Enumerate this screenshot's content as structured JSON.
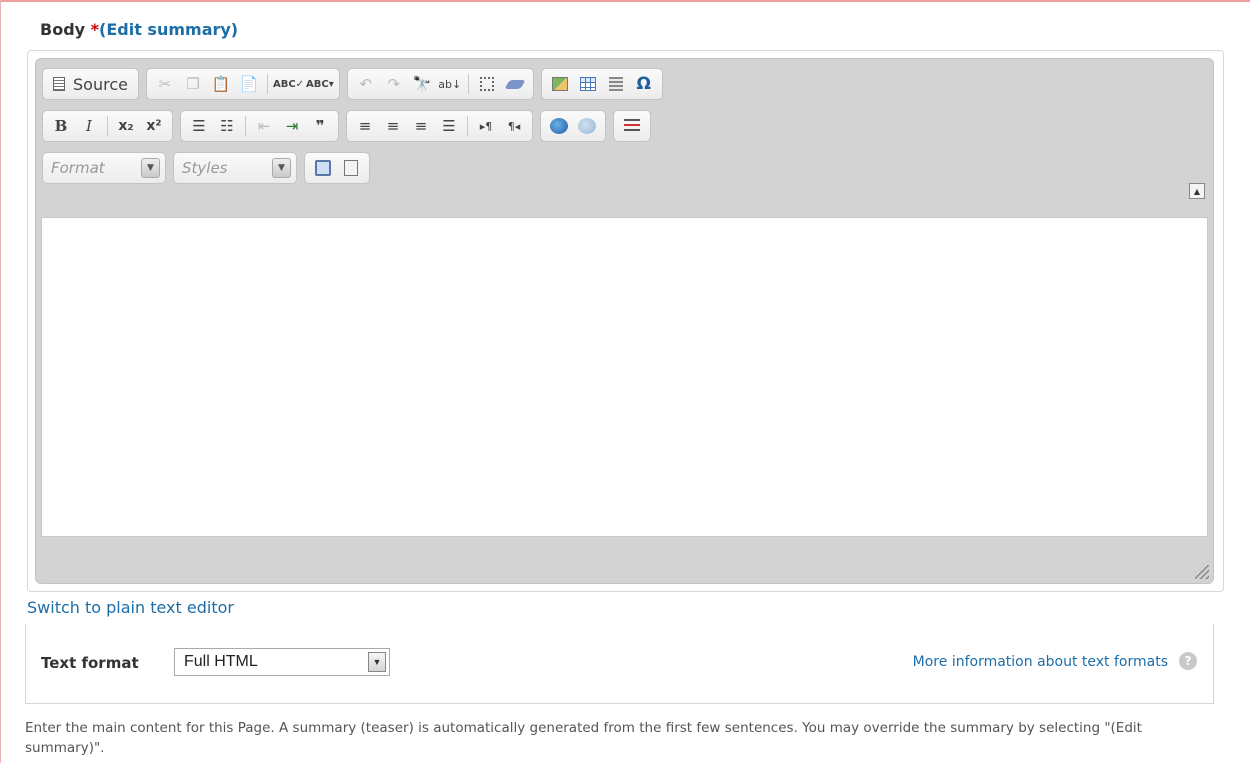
{
  "field": {
    "label": "Body",
    "required_mark": "*",
    "edit_summary_link": "(Edit summary)"
  },
  "toolbar": {
    "source_label": "Source",
    "format_placeholder": "Format",
    "styles_placeholder": "Styles",
    "row1_icons": [
      "source-icon",
      "cut-icon",
      "copy-icon",
      "paste-icon",
      "paste-from-word-icon",
      "spellcheck-icon",
      "spellcheck-as-you-type-icon",
      "undo-icon",
      "redo-icon",
      "find-icon",
      "replace-icon",
      "select-all-icon",
      "remove-format-icon",
      "image-icon",
      "table-icon",
      "horizontal-rule-icon",
      "special-char-icon"
    ],
    "row2_icons": [
      "bold-icon",
      "italic-icon",
      "subscript-icon",
      "superscript-icon",
      "numbered-list-icon",
      "bulleted-list-icon",
      "outdent-icon",
      "indent-icon",
      "blockquote-icon",
      "align-left-icon",
      "align-center-icon",
      "align-right-icon",
      "justify-icon",
      "ltr-icon",
      "rtl-icon",
      "link-icon",
      "unlink-icon",
      "page-break-icon"
    ],
    "row3_icons": [
      "maximize-icon",
      "show-blocks-icon"
    ]
  },
  "editor": {
    "content": ""
  },
  "switch_link": "Switch to plain text editor",
  "text_format": {
    "label": "Text format",
    "selected": "Full HTML",
    "more_info_link": "More information about text formats",
    "help_icon": "?"
  },
  "description": "Enter the main content for this Page. A summary (teaser) is automatically generated from the first few sentences. You may override the summary by selecting \"(Edit summary)\".",
  "colors": {
    "link": "#1d6ea8",
    "required": "#cc0000",
    "toolbar_bg": "#d3d3d3"
  }
}
